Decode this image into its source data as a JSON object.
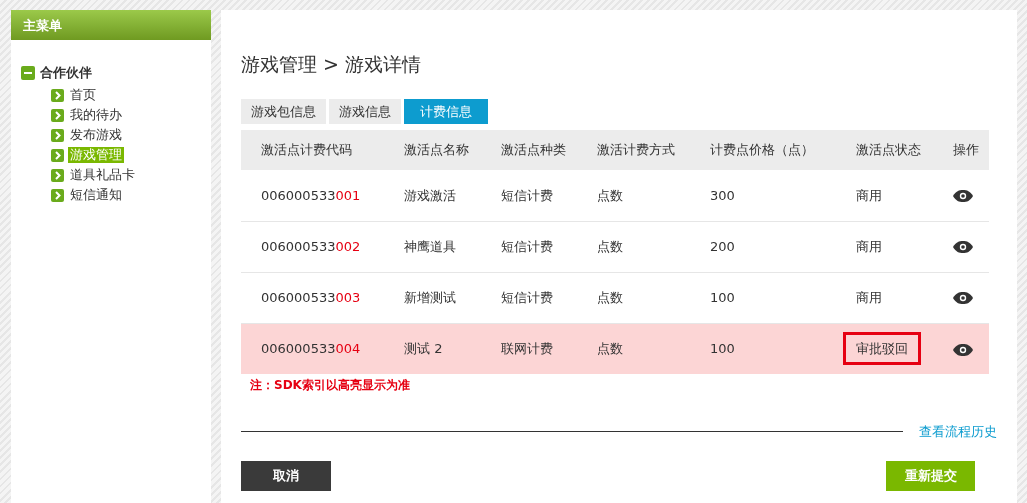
{
  "sidebar": {
    "title": "主菜单",
    "group": {
      "label": "合作伙伴",
      "expanded": true,
      "items": [
        {
          "label": "首页",
          "selected": false
        },
        {
          "label": "我的待办",
          "selected": false
        },
        {
          "label": "发布游戏",
          "selected": false
        },
        {
          "label": "游戏管理",
          "selected": true
        },
        {
          "label": "道具礼品卡",
          "selected": false
        },
        {
          "label": "短信通知",
          "selected": false
        }
      ]
    }
  },
  "breadcrumb": "游戏管理 > 游戏详情",
  "tabs": [
    {
      "label": "游戏包信息",
      "selected": false
    },
    {
      "label": "游戏信息",
      "selected": false
    },
    {
      "label": "计费信息",
      "selected": true
    }
  ],
  "table": {
    "columns": [
      "激活点计费代码",
      "激活点名称",
      "激活点种类",
      "激活计费方式",
      "计费点价格（点）",
      "激活点状态",
      "操作"
    ],
    "rows": [
      {
        "code_prefix": "006000533",
        "code_suffix": "001",
        "name": "游戏激活",
        "type": "短信计费",
        "method": "点数",
        "price": "300",
        "status": "商用",
        "highlighted": false,
        "flagged": false
      },
      {
        "code_prefix": "006000533",
        "code_suffix": "002",
        "name": "神鹰道具",
        "type": "短信计费",
        "method": "点数",
        "price": "200",
        "status": "商用",
        "highlighted": false,
        "flagged": false
      },
      {
        "code_prefix": "006000533",
        "code_suffix": "003",
        "name": "新增测试",
        "type": "短信计费",
        "method": "点数",
        "price": "100",
        "status": "商用",
        "highlighted": false,
        "flagged": false
      },
      {
        "code_prefix": "006000533",
        "code_suffix": "004",
        "name": "测试 2",
        "type": "联网计费",
        "method": "点数",
        "price": "100",
        "status": "审批驳回",
        "highlighted": true,
        "flagged": true
      }
    ]
  },
  "note": "注：SDK索引以高亮显示为准",
  "history_link": "查看流程历史",
  "buttons": {
    "cancel": "取消",
    "resubmit": "重新提交"
  }
}
